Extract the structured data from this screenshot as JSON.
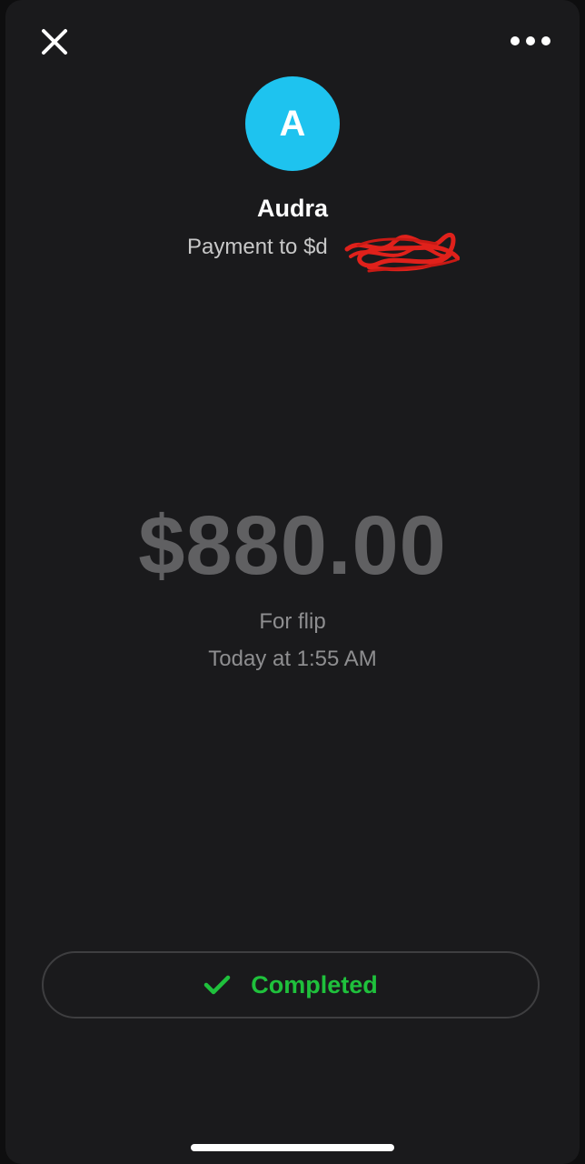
{
  "header": {
    "close_icon": "close-icon",
    "more_icon": "more-horizontal-icon"
  },
  "recipient": {
    "avatar_initial": "A",
    "avatar_color": "#1ec3ef",
    "name": "Audra",
    "payment_to": "Payment to $d"
  },
  "transaction": {
    "amount": "$880.00",
    "note": "For flip",
    "timestamp": "Today at 1:55 AM"
  },
  "status": {
    "label": "Completed",
    "icon": "checkmark-icon",
    "color": "#1fc13c"
  }
}
